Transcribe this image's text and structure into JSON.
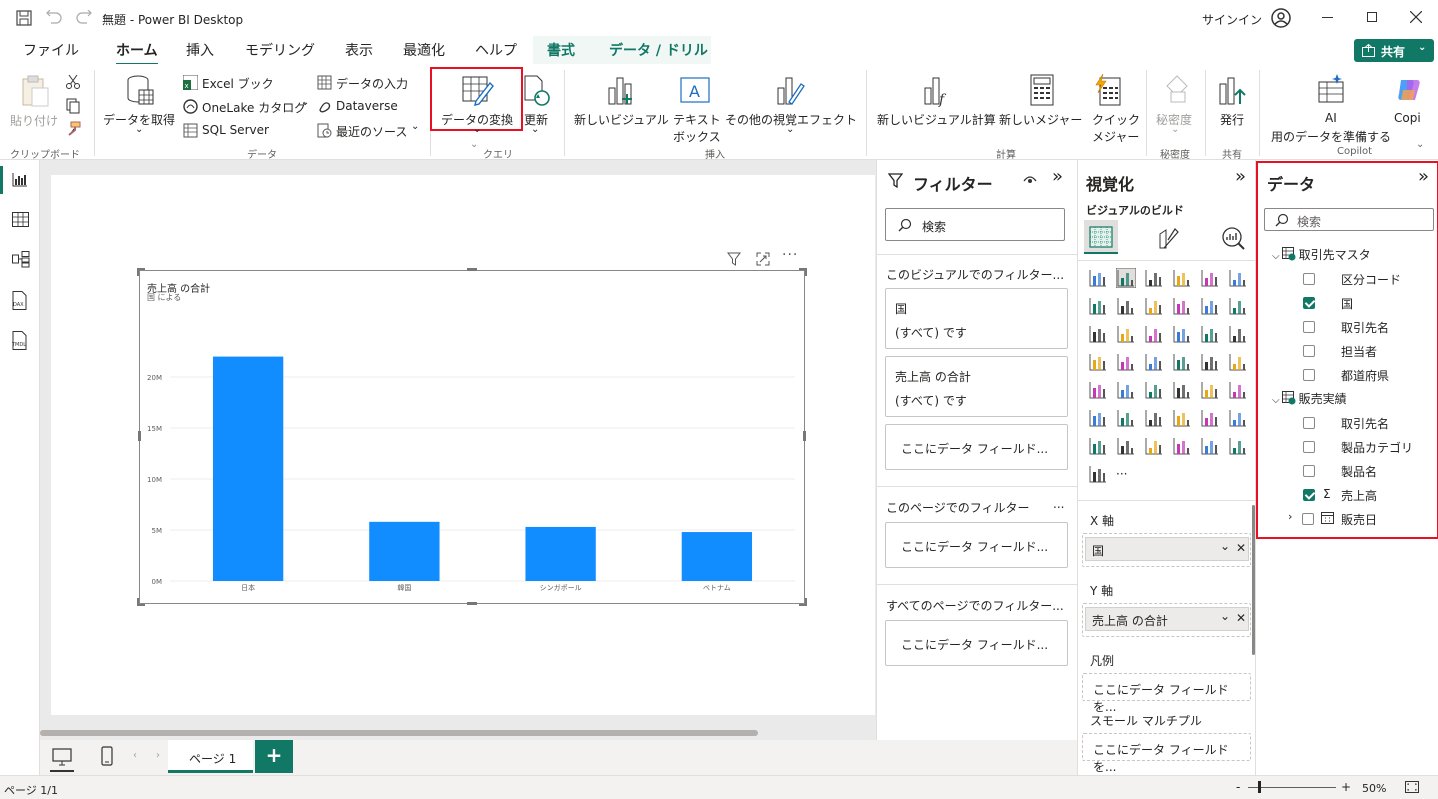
{
  "window": {
    "title": "無題 - Power BI Desktop",
    "signin": "サインイン"
  },
  "ribbon_tabs": [
    "ファイル",
    "ホーム",
    "挿入",
    "モデリング",
    "表示",
    "最適化",
    "ヘルプ",
    "書式",
    "データ / ドリル"
  ],
  "share_label": "共有",
  "ribbon": {
    "paste": "貼り付け",
    "clipboard_group": "クリップボード",
    "get_data": "データを取得",
    "excel": "Excel ブック",
    "onelake": "OneLake カタログ",
    "sqlserver": "SQL Server",
    "enter_data": "データの入力",
    "dataverse": "Dataverse",
    "recent_sources": "最近のソース",
    "data_group": "データ",
    "transform": "データの変換",
    "refresh": "更新",
    "query_group": "クエリ",
    "new_visual": "新しいビジュアル",
    "textbox_1": "テキスト",
    "textbox_2": "ボックス",
    "more_visuals": "その他の視覚エフェクト",
    "insert_group": "挿入",
    "new_visual_calc": "新しいビジュアル計算",
    "new_measure": "新しいメジャー",
    "quick_measure_1": "クイック",
    "quick_measure_2": "メジャー",
    "calc_group": "計算",
    "sensitivity": "秘密度",
    "sensitivity_group": "秘密度",
    "publish": "発行",
    "share_group": "共有",
    "ai_1": "AI",
    "ai_2": "用のデータを準備する",
    "copilot": "Copi",
    "copilot_group": "Copilot"
  },
  "chart_data": {
    "type": "bar",
    "title": "売上高 の合計",
    "subtitle": "国 による",
    "categories": [
      "日本",
      "韓国",
      "シンガポール",
      "ベトナム"
    ],
    "values": [
      22000000,
      5800000,
      5300000,
      4800000
    ],
    "ylim": [
      0,
      25000000
    ],
    "yticks": [
      "0M",
      "5M",
      "10M",
      "15M",
      "20M"
    ],
    "ytick_values": [
      0,
      5000000,
      10000000,
      15000000,
      20000000
    ],
    "bar_color": "#118dff",
    "grid": true
  },
  "filters": {
    "title": "フィルター",
    "search_placeholder": "検索",
    "visual_section": "このビジュアルでのフィルター...",
    "card1_title": "国",
    "card1_value": "(すべて) です",
    "card2_title": "売上高 の合計",
    "card2_value": "(すべて) です",
    "drop_here": "ここにデータ フィールド...",
    "page_section": "このページでのフィルター",
    "page_more": "...",
    "all_pages_section": "すべてのページでのフィルター..."
  },
  "viz": {
    "title": "視覚化",
    "build_label": "ビジュアルのビルド",
    "more": "...",
    "x_axis": "X 軸",
    "x_field": "国",
    "y_axis": "Y 軸",
    "y_field": "売上高 の合計",
    "legend": "凡例",
    "legend_drop": "ここにデータ フィールドを...",
    "small_multiples": "スモール マルチプル",
    "sm_drop": "ここにデータ フィールドを..."
  },
  "data": {
    "title": "データ",
    "search_placeholder": "検索",
    "table1": "取引先マスタ",
    "table1_fields": [
      {
        "label": "区分コード",
        "checked": false
      },
      {
        "label": "国",
        "checked": true
      },
      {
        "label": "取引先名",
        "checked": false
      },
      {
        "label": "担当者",
        "checked": false
      },
      {
        "label": "都道府県",
        "checked": false
      }
    ],
    "table2": "販売実績",
    "table2_fields": [
      {
        "label": "取引先名",
        "checked": false
      },
      {
        "label": "製品カテゴリ",
        "checked": false
      },
      {
        "label": "製品名",
        "checked": false
      },
      {
        "label": "売上高",
        "checked": true,
        "sigma": true
      },
      {
        "label": "販売日",
        "checked": false,
        "expandable": true
      }
    ],
    "sigma": "Σ"
  },
  "page_tab": "ページ 1",
  "status": {
    "page": "ページ 1/1",
    "zoom": "50%",
    "minus": "-",
    "plus": "+"
  },
  "colors": {
    "accent": "#117865",
    "highlight_red": "#e81123",
    "bar": "#118dff"
  }
}
